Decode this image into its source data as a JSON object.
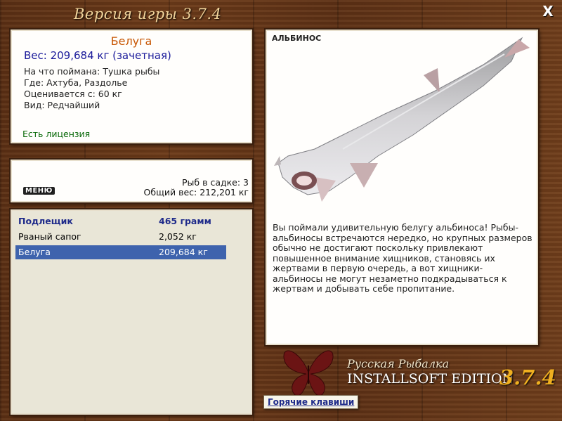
{
  "header": {
    "title": "Версия игры  3.7.4",
    "close_label": "X"
  },
  "catch": {
    "name": "Белуга",
    "weight": "Вес: 209,684 кг (зачетная)",
    "lines": [
      "На что поймана: Тушка рыбы",
      "Где: Ахтуба, Раздолье",
      "Оценивается с: 60 кг",
      "Вид: Редчайший"
    ],
    "license": "Есть лицензия"
  },
  "keepnet": {
    "menu_label": "МЕНЮ",
    "count": "Рыб в садке: 3",
    "total": "Общий вес: 212,201 кг"
  },
  "fish_list": [
    {
      "name": "Подлещик",
      "weight": "465 грамм"
    },
    {
      "name": "Рваный сапог",
      "weight": "2,052 кг"
    },
    {
      "name": "Белуга",
      "weight": "209,684 кг"
    }
  ],
  "detail": {
    "badge": "АЛЬБИНОС",
    "description": "Вы поймали удивительную белугу альбиноса! Рыбы-альбиносы встречаются нередко, но крупных размеров обычно не достигают поскольку привлекают повышенное внимание хищников, становясь их жертвами в первую очередь, а вот хищники-альбиносы не могут незаметно подкрадываться к жертвам и добывать себе пропитание."
  },
  "logo": {
    "line1": "Русская Рыбалка",
    "line2": "INSTALLSOFT EDITION",
    "version": "3.7.4"
  },
  "hotkeys_label": "Горячие клавиши",
  "icons": {
    "close": "close-icon",
    "logo": "butterfly-logo-icon",
    "fish": "beluga-fish-image"
  }
}
